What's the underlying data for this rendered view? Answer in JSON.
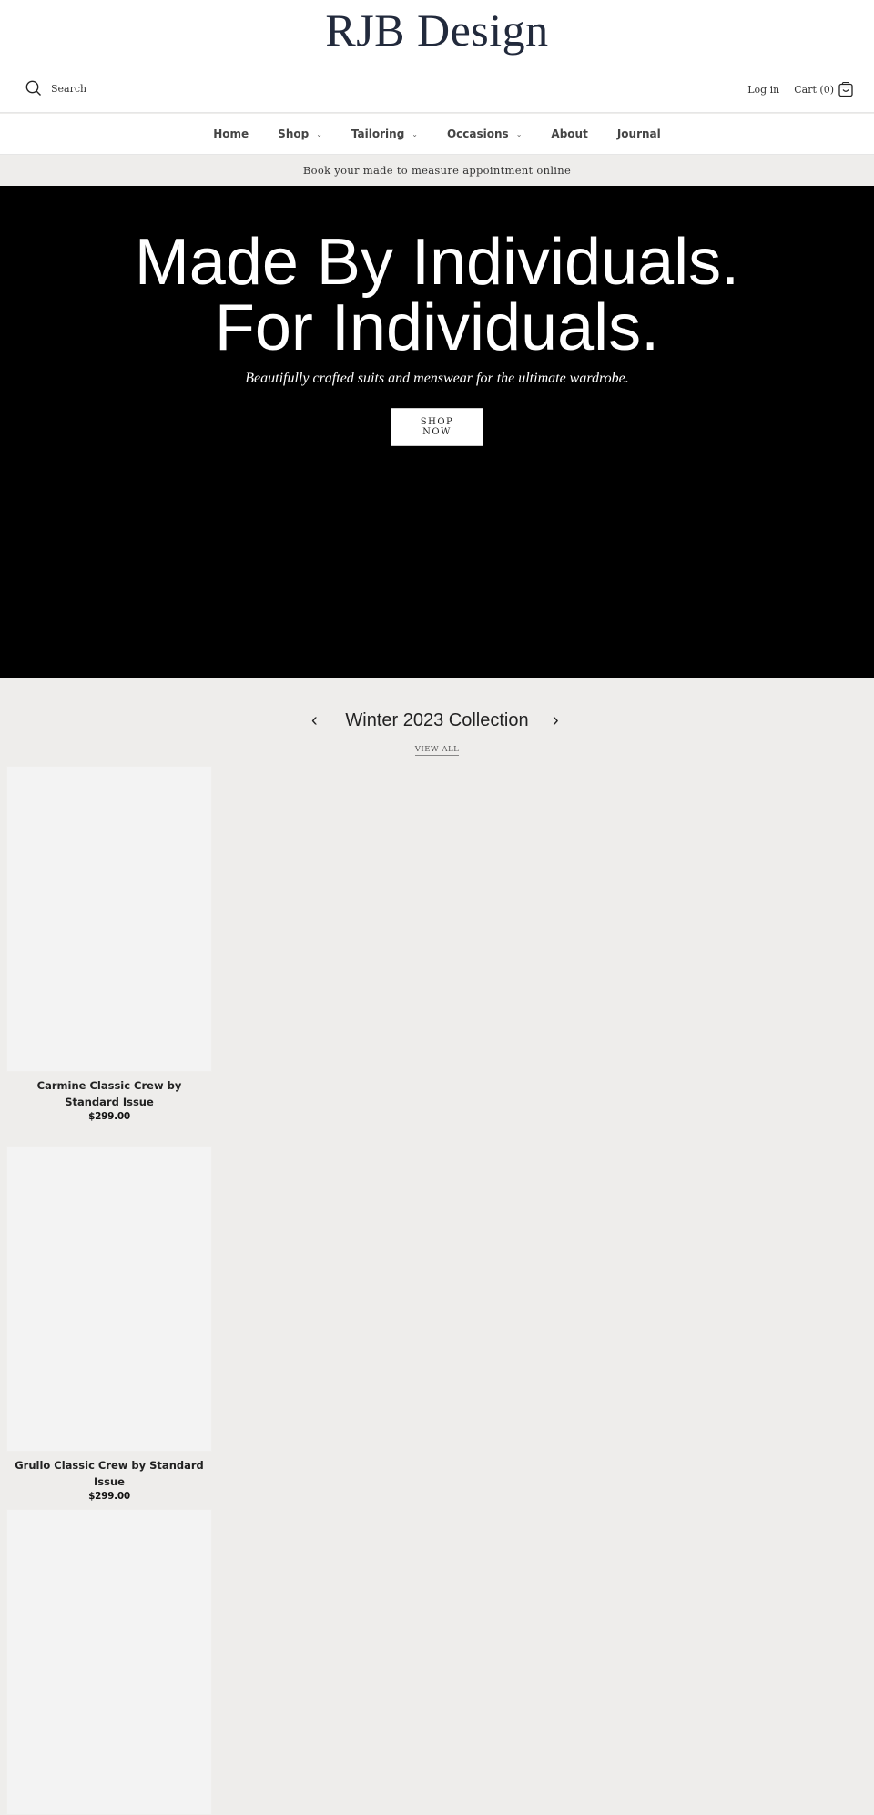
{
  "header": {
    "logo": "RJB Design",
    "search_label": "Search",
    "login_label": "Log in",
    "cart_label": "Cart (0)"
  },
  "nav": {
    "items": [
      {
        "label": "Home",
        "has_dropdown": false
      },
      {
        "label": "Shop",
        "has_dropdown": true
      },
      {
        "label": "Tailoring",
        "has_dropdown": true
      },
      {
        "label": "Occasions",
        "has_dropdown": true
      },
      {
        "label": "About",
        "has_dropdown": false
      },
      {
        "label": "Journal",
        "has_dropdown": false
      }
    ]
  },
  "announcement": "Book your made to measure appointment online",
  "hero": {
    "line1": "Made By Individuals.",
    "line2": "For Individuals.",
    "subtitle": "Beautifully crafted suits and menswear for the ultimate wardrobe.",
    "button_label": "SHOP\nNOW"
  },
  "collection": {
    "title": "Winter 2023 Collection",
    "view_all": "VIEW ALL",
    "products": [
      {
        "title": "Carmine Classic Crew by Standard Issue",
        "price": "$299.00"
      },
      {
        "title": "Grullo Classic Crew by Standard Issue",
        "price": "$299.00"
      },
      {
        "title": "",
        "price": ""
      }
    ]
  }
}
